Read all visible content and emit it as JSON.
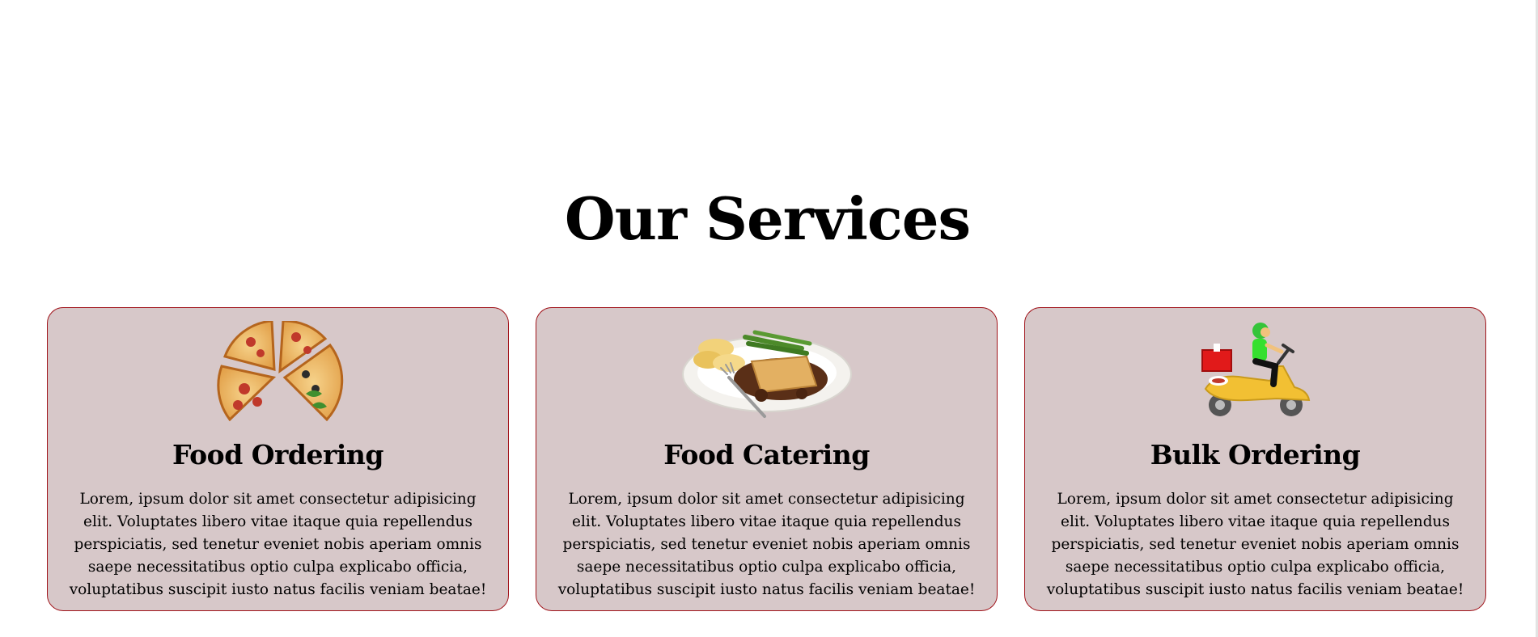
{
  "section": {
    "title": "Our Services"
  },
  "services": [
    {
      "icon": "pizza-slices-image",
      "title": "Food Ordering",
      "description": "Lorem, ipsum dolor sit amet consectetur adipisicing elit. Voluptates libero vitae itaque quia repellendus perspiciatis, sed tenetur eveniet nobis aperiam omnis saepe necessitatibus optio culpa explicabo officia, voluptatibus suscipit iusto natus facilis veniam beatae!"
    },
    {
      "icon": "catering-plate-image",
      "title": "Food Catering",
      "description": "Lorem, ipsum dolor sit amet consectetur adipisicing elit. Voluptates libero vitae itaque quia repellendus perspiciatis, sed tenetur eveniet nobis aperiam omnis saepe necessitatibus optio culpa explicabo officia, voluptatibus suscipit iusto natus facilis veniam beatae!"
    },
    {
      "icon": "delivery-scooter-image",
      "title": "Bulk Ordering",
      "description": "Lorem, ipsum dolor sit amet consectetur adipisicing elit. Voluptates libero vitae itaque quia repellendus perspiciatis, sed tenetur eveniet nobis aperiam omnis saepe necessitatibus optio culpa explicabo officia, voluptatibus suscipit iusto natus facilis veniam beatae!"
    }
  ],
  "colors": {
    "card_background": "#d7c8c9",
    "card_border": "#a1141b",
    "text": "#000000"
  }
}
